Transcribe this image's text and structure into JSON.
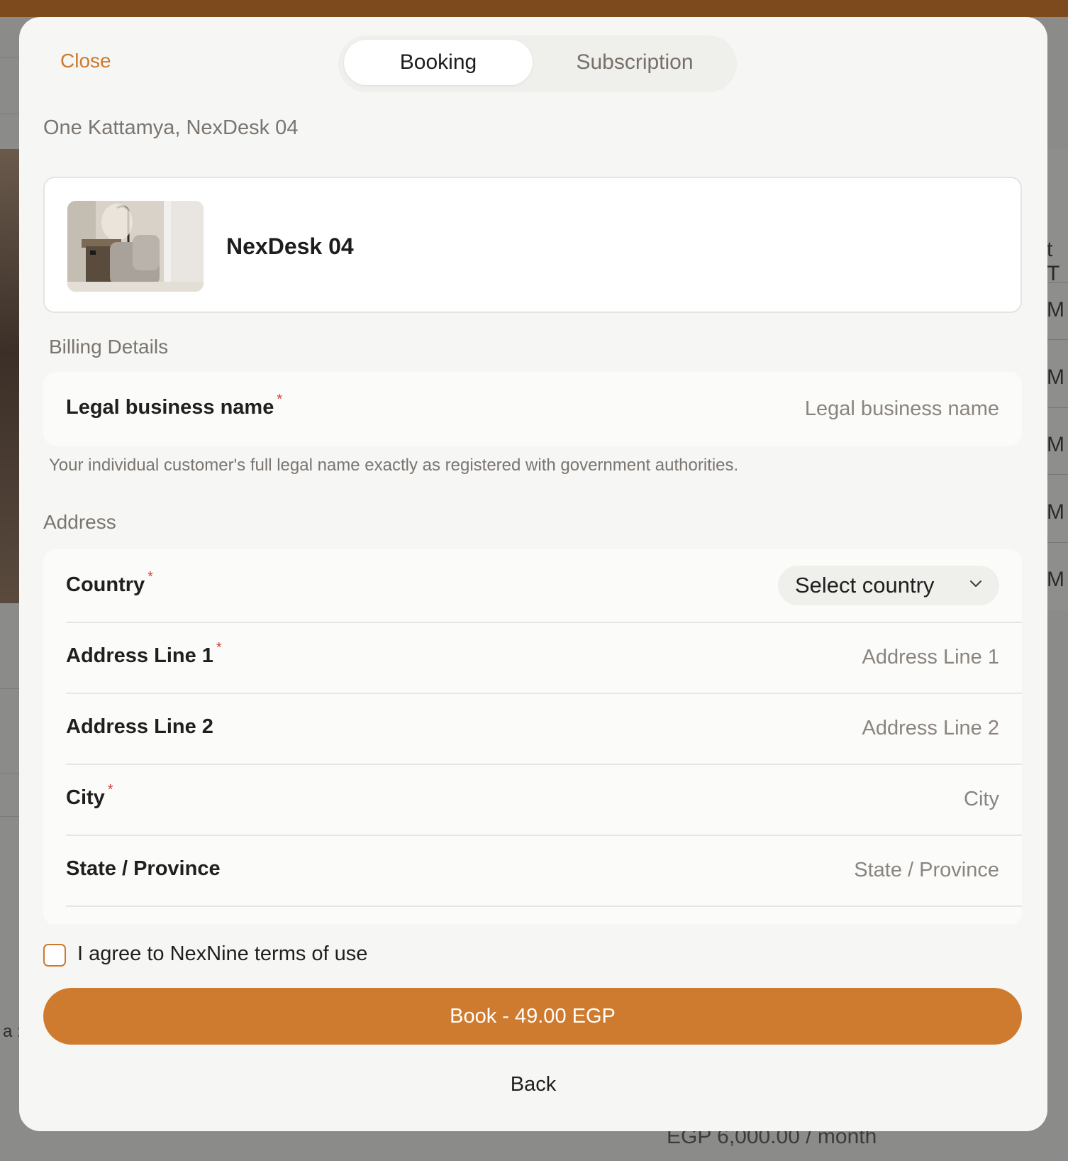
{
  "header": {
    "close_label": "Close",
    "tabs": [
      {
        "label": "Booking",
        "active": true
      },
      {
        "label": "Subscription",
        "active": false
      }
    ]
  },
  "location": "One Kattamya, NexDesk 04",
  "desk": {
    "name": "NexDesk 04"
  },
  "billing": {
    "section_title": "Billing Details",
    "legal_name": {
      "label": "Legal business name",
      "required_mark": "*",
      "placeholder": "Legal business name",
      "value": ""
    },
    "helper_text": "Your individual customer's full legal name exactly as registered with government authorities."
  },
  "address": {
    "section_title": "Address",
    "country": {
      "label": "Country",
      "required_mark": "*",
      "selected": "Select country"
    },
    "line1": {
      "label": "Address Line 1",
      "required_mark": "*",
      "placeholder": "Address Line 1"
    },
    "line2": {
      "label": "Address Line 2",
      "placeholder": "Address Line 2"
    },
    "city": {
      "label": "City",
      "required_mark": "*",
      "placeholder": "City"
    },
    "state": {
      "label": "State / Province",
      "placeholder": "State / Province"
    }
  },
  "terms": {
    "label": "I agree to NexNine terms of use",
    "checked": false
  },
  "actions": {
    "book_label": "Book - 49.00 EGP",
    "back_label": "Back"
  },
  "background": {
    "price_text": "EGP 6,000.00 / month",
    "right_letters": [
      "t T",
      "M",
      "M",
      "M",
      "M",
      "M"
    ],
    "left_snippet": "a :"
  },
  "colors": {
    "accent": "#cf7b2f",
    "required": "#d0453a",
    "top_bar": "#7d4a1e"
  }
}
